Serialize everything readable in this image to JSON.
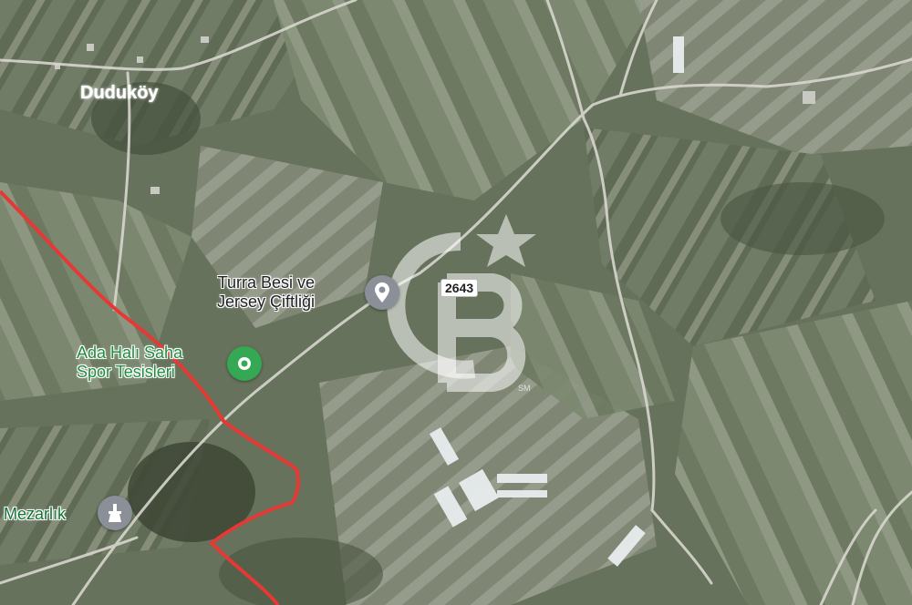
{
  "map": {
    "places": {
      "town": "Duduköy",
      "farm": "Turra Besi ve\nJersey Çiftliği",
      "sports": "Ada Halı Saha\nSpor Tesisleri",
      "cemetery": "Mezarlık"
    },
    "road_number": "2643",
    "watermark_mark": "SM",
    "icons": {
      "farm_pin": "location-pin-icon",
      "sports_pin": "location-pin-icon",
      "cemetery_pin": "monument-icon",
      "watermark_star": "star-icon"
    },
    "colors": {
      "boundary": "#e53935",
      "road": "#d9d9d9",
      "sports_pin": "#34a853",
      "farm_pin": "#8a8f98",
      "cemetery_pin": "#8a8f98"
    }
  }
}
